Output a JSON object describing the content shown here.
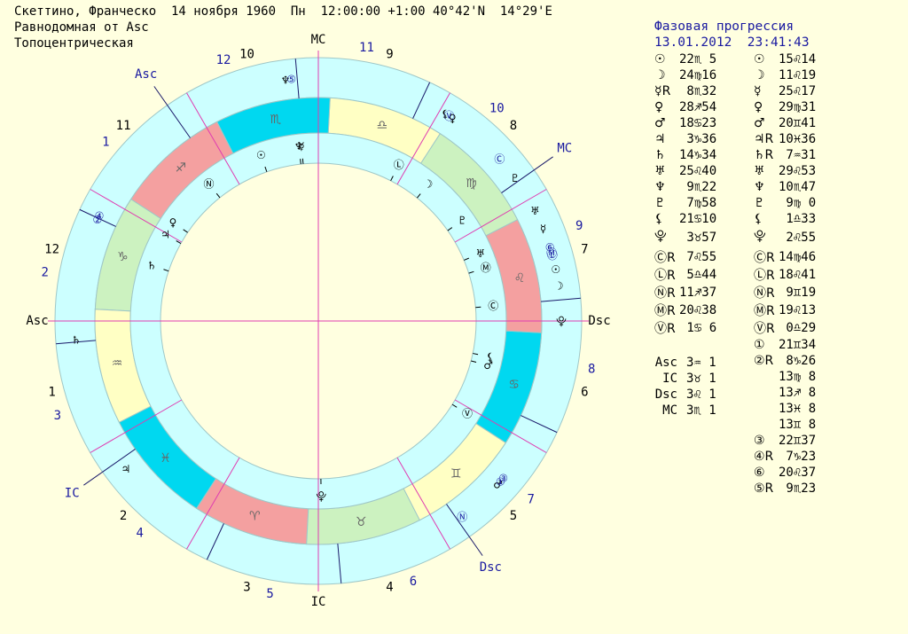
{
  "header": {
    "line1": "Скеттино, Франческо  14 ноября 1960  Пн  12:00:00 +1:00 40°42'N  14°29'E",
    "line2": "Равнодомная от Asc",
    "line3": "Топоцентрическая"
  },
  "progression": {
    "title": "Фазовая прогрессия",
    "datetime": "13.01.2012  23:41:43"
  },
  "colors": {
    "background": "#ffffe0",
    "ring_outer": "#ccffff",
    "sign_fire": "#f4a0a0",
    "sign_earth": "#ccf2c0",
    "sign_air": "#ffffc4",
    "sign_water": "#00d8f0",
    "cusp_line": "#e03cb0",
    "nav_text": "#1a1aa0"
  },
  "natal_positions": [
    {
      "symbol": "☉",
      "value": "22♏ 5"
    },
    {
      "symbol": "☽",
      "value": "24♍16"
    },
    {
      "symbol": "☿R",
      "value": " 8♏32"
    },
    {
      "symbol": "♀",
      "value": "28♐54"
    },
    {
      "symbol": "♂",
      "value": "18♋23"
    },
    {
      "symbol": "♃",
      "value": " 3♑36"
    },
    {
      "symbol": "♄",
      "value": "14♑34"
    },
    {
      "symbol": "♅",
      "value": "25♌40"
    },
    {
      "symbol": "♆",
      "value": " 9♏22"
    },
    {
      "symbol": "♇",
      "value": " 7♍58"
    },
    {
      "symbol": "⚸",
      "value": "21♋10"
    },
    {
      "symbol": "⯓",
      "value": " 3♉57"
    },
    {
      "symbol": "ⒸR",
      "value": " 7♌55"
    },
    {
      "symbol": "ⓁR",
      "value": " 5♎44"
    },
    {
      "symbol": "ⓃR",
      "value": "11♐37"
    },
    {
      "symbol": "ⓂR",
      "value": "20♌38"
    },
    {
      "symbol": "ⓋR",
      "value": " 1♋ 6"
    }
  ],
  "progressed_positions": [
    {
      "symbol": "☉",
      "value": "15♌14"
    },
    {
      "symbol": "☽",
      "value": "11♌19"
    },
    {
      "symbol": "☿",
      "value": "25♌17"
    },
    {
      "symbol": "♀",
      "value": "29♍31"
    },
    {
      "symbol": "♂",
      "value": "20♊41"
    },
    {
      "symbol": "♃R",
      "value": "10♓36"
    },
    {
      "symbol": "♄R",
      "value": " 7♒31"
    },
    {
      "symbol": "♅",
      "value": "29♌53"
    },
    {
      "symbol": "♆",
      "value": "10♏47"
    },
    {
      "symbol": "♇",
      "value": " 9♍ 0"
    },
    {
      "symbol": "⚸",
      "value": " 1♎33"
    },
    {
      "symbol": "⯓",
      "value": " 2♌55"
    },
    {
      "symbol": "ⒸR",
      "value": "14♍46"
    },
    {
      "symbol": "ⓁR",
      "value": "18♌41"
    },
    {
      "symbol": "ⓃR",
      "value": " 9♊19"
    },
    {
      "symbol": "ⓂR",
      "value": "19♌13"
    },
    {
      "symbol": "ⓋR",
      "value": " 0♎29"
    },
    {
      "symbol": "①",
      "value": "21♊34"
    },
    {
      "symbol": "②R",
      "value": " 8♑26"
    },
    {
      "symbol": "",
      "value": "13♍ 8"
    },
    {
      "symbol": "",
      "value": "13♐ 8"
    },
    {
      "symbol": "",
      "value": "13♓ 8"
    },
    {
      "symbol": "",
      "value": "13♊ 8"
    },
    {
      "symbol": "③",
      "value": "22♊37"
    },
    {
      "symbol": "④R",
      "value": " 7♑23"
    },
    {
      "symbol": "⑥",
      "value": "20♌37"
    },
    {
      "symbol": "⑤R",
      "value": " 9♏23"
    }
  ],
  "angles": [
    {
      "label": "Asc",
      "value": "3♒ 1"
    },
    {
      "label": "IC",
      "value": "3♉ 1"
    },
    {
      "label": "Dsc",
      "value": "3♌ 1"
    },
    {
      "label": "MC",
      "value": "3♏ 1"
    }
  ],
  "wheel": {
    "natal_asc_deg": 303.02,
    "progressed_asc_deg": 248.0,
    "signs": [
      {
        "glyph": "♈",
        "element": "fire"
      },
      {
        "glyph": "♉",
        "element": "earth"
      },
      {
        "glyph": "♊",
        "element": "air"
      },
      {
        "glyph": "♋",
        "element": "water"
      },
      {
        "glyph": "♌",
        "element": "fire"
      },
      {
        "glyph": "♍",
        "element": "earth"
      },
      {
        "glyph": "♎",
        "element": "air"
      },
      {
        "glyph": "♏",
        "element": "water"
      },
      {
        "glyph": "♐",
        "element": "fire"
      },
      {
        "glyph": "♑",
        "element": "earth"
      },
      {
        "glyph": "♒",
        "element": "air"
      },
      {
        "glyph": "♓",
        "element": "water"
      }
    ],
    "axis_labels": {
      "asc": "Asc",
      "dsc": "Dsc",
      "mc": "MC",
      "ic": "IC"
    },
    "prog_axis_labels": {
      "asc": "Asc",
      "dsc": "Dsc",
      "mc": "MC",
      "ic": "IC"
    },
    "natal_house_numbers": [
      "1",
      "2",
      "3",
      "4",
      "5",
      "6",
      "7",
      "8",
      "9",
      "10",
      "11",
      "12"
    ],
    "prog_house_numbers": [
      "1",
      "2",
      "3",
      "4",
      "5",
      "6",
      "7",
      "8",
      "9",
      "10",
      "11",
      "12"
    ],
    "natal_planets_inner": [
      {
        "glyph": "☉",
        "lon": 232.08
      },
      {
        "glyph": "☽",
        "lon": 174.27
      },
      {
        "glyph": "☿",
        "lon": 218.53
      },
      {
        "glyph": "♀",
        "lon": 268.9
      },
      {
        "glyph": "♂",
        "lon": 108.38
      },
      {
        "glyph": "♃",
        "lon": 273.6
      },
      {
        "glyph": "♄",
        "lon": 284.57
      },
      {
        "glyph": "♅",
        "lon": 145.67
      },
      {
        "glyph": "♆",
        "lon": 219.37
      },
      {
        "glyph": "♇",
        "lon": 157.97
      },
      {
        "glyph": "⚸",
        "lon": 111.17
      },
      {
        "glyph": "⯓",
        "lon": 33.95
      },
      {
        "glyph": "Ⓒ",
        "lon": 127.92
      },
      {
        "glyph": "Ⓛ",
        "lon": 185.73
      },
      {
        "glyph": "Ⓝ",
        "lon": 251.62
      },
      {
        "glyph": "Ⓜ",
        "lon": 140.63
      },
      {
        "glyph": "Ⓥ",
        "lon": 91.1
      }
    ],
    "prog_planets_outer": [
      {
        "glyph": "☉",
        "lon": 135.23
      },
      {
        "glyph": "☽",
        "lon": 131.32
      },
      {
        "glyph": "☿",
        "lon": 145.28
      },
      {
        "glyph": "♀",
        "lon": 179.52
      },
      {
        "glyph": "♂",
        "lon": 80.68
      },
      {
        "glyph": "♃",
        "lon": 340.6
      },
      {
        "glyph": "♄",
        "lon": 307.52
      },
      {
        "glyph": "♅",
        "lon": 149.88
      },
      {
        "glyph": "♆",
        "lon": 220.78
      },
      {
        "glyph": "♇",
        "lon": 159.0
      },
      {
        "glyph": "⚸",
        "lon": 181.55
      },
      {
        "glyph": "⯓",
        "lon": 122.92
      },
      {
        "glyph": "Ⓒ",
        "lon": 164.77
      },
      {
        "glyph": "Ⓛ",
        "lon": 138.68
      },
      {
        "glyph": "Ⓝ",
        "lon": 69.32
      },
      {
        "glyph": "Ⓜ",
        "lon": 139.22
      },
      {
        "glyph": "Ⓥ",
        "lon": 180.48
      },
      {
        "glyph": "①",
        "lon": 81.57
      },
      {
        "glyph": "②",
        "lon": 278.43
      },
      {
        "glyph": "③",
        "lon": 82.62
      },
      {
        "glyph": "④",
        "lon": 277.38
      },
      {
        "glyph": "⑥",
        "lon": 140.62
      },
      {
        "glyph": "⑤",
        "lon": 219.38
      }
    ]
  }
}
